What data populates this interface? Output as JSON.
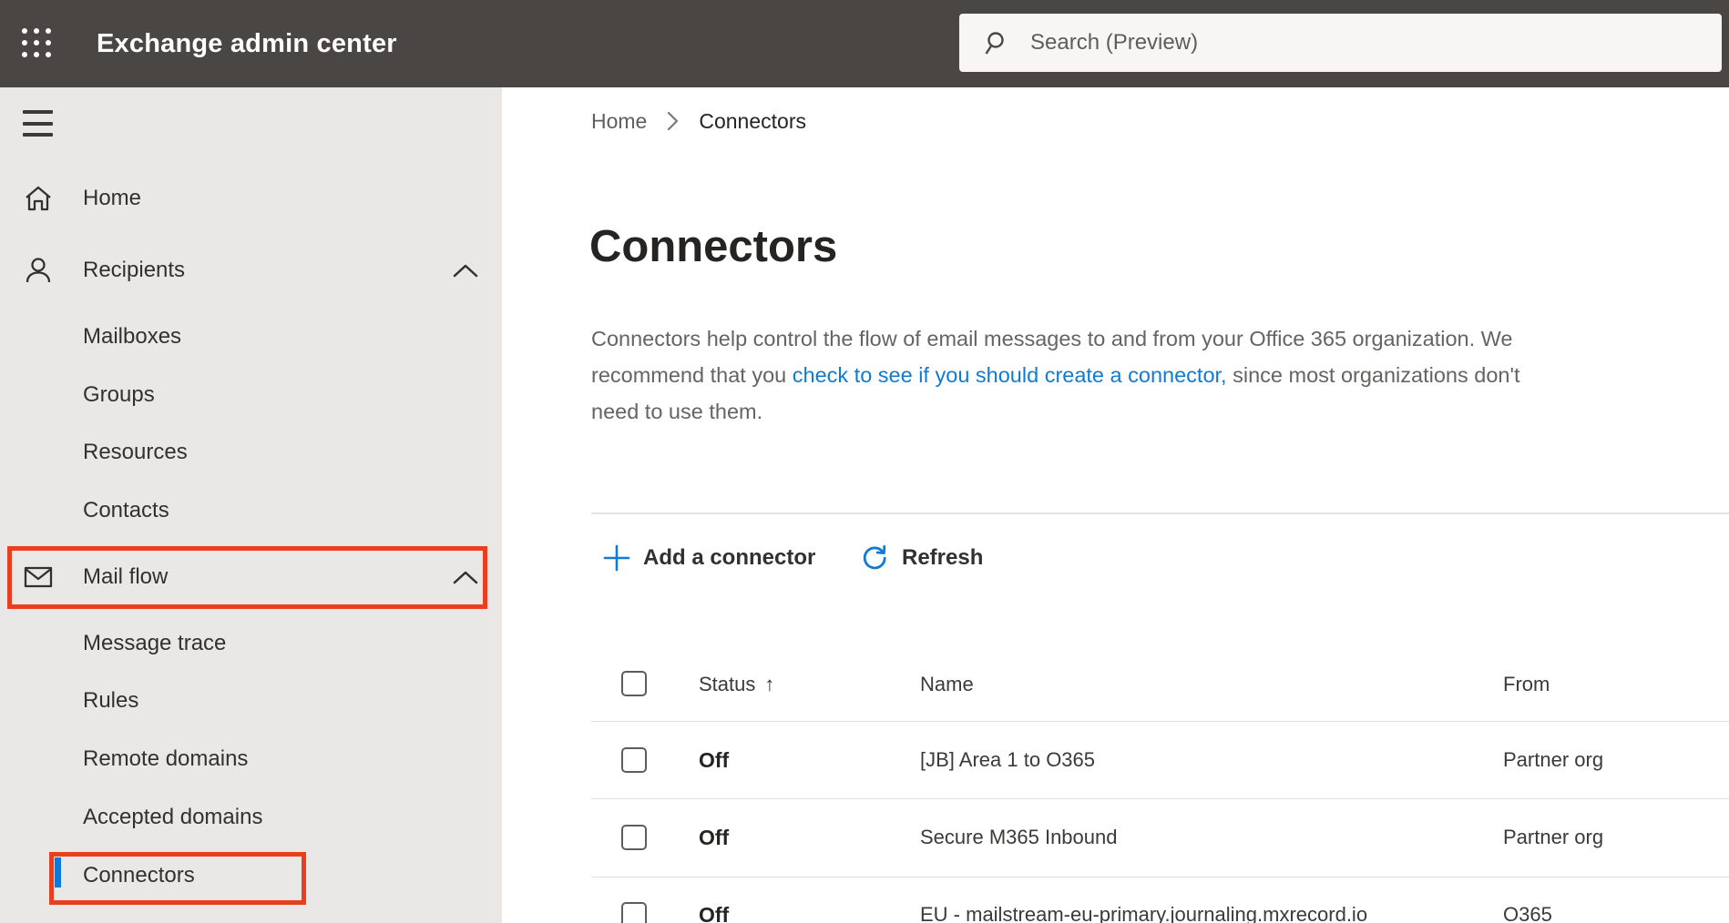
{
  "topbar": {
    "title": "Exchange admin center",
    "search_placeholder": "Search (Preview)",
    "bg_color": "#4a4643"
  },
  "sidebar": {
    "bg_color": "#e9e8e6",
    "items": [
      {
        "label": "Home"
      },
      {
        "label": "Recipients"
      },
      {
        "label": "Mailboxes"
      },
      {
        "label": "Groups"
      },
      {
        "label": "Resources"
      },
      {
        "label": "Contacts"
      },
      {
        "label": "Mail flow"
      },
      {
        "label": "Message trace"
      },
      {
        "label": "Rules"
      },
      {
        "label": "Remote domains"
      },
      {
        "label": "Accepted domains"
      },
      {
        "label": "Connectors"
      }
    ],
    "selected_item": "Connectors",
    "selection_bar_color": "#0c7bd8",
    "annotation_color": "#e8401f",
    "annotated_items": [
      "Mail flow",
      "Connectors"
    ]
  },
  "breadcrumb": {
    "home": "Home",
    "current": "Connectors"
  },
  "page": {
    "title": "Connectors",
    "description": {
      "line1": "Connectors help control the flow of email messages to and from your Office 365 organization. We",
      "line2_pre": "recommend that you ",
      "line2_link": "check to see if you should create a connector,",
      "line2_post": " since most organizations don't",
      "line3": "need to use them."
    },
    "link_color": "#0f7bd4"
  },
  "toolbar": {
    "add_label": "Add a connector",
    "refresh_label": "Refresh",
    "icon_color": "#0f7bd4"
  },
  "table": {
    "columns": {
      "status": "Status",
      "name": "Name",
      "from": "From"
    },
    "sort_icon": "↑",
    "rows": [
      {
        "status": "Off",
        "name": "[JB] Area 1 to O365",
        "from": "Partner org"
      },
      {
        "status": "Off",
        "name": "Secure M365 Inbound",
        "from": "Partner org"
      },
      {
        "status": "Off",
        "name": "EU - mailstream-eu-primary.journaling.mxrecord.io",
        "from": "O365"
      }
    ]
  },
  "icons": {
    "app_launcher": "waffle-grid",
    "search": "magnifier",
    "nav_toggle": "hamburger",
    "home": "house-outline",
    "recipients": "person-outline",
    "mail_flow": "envelope-outline",
    "expand_state": "chevron-up",
    "breadcrumb_separator": "chevron-right",
    "add": "plus",
    "refresh": "circular-arrow",
    "sort": "up-arrow"
  }
}
